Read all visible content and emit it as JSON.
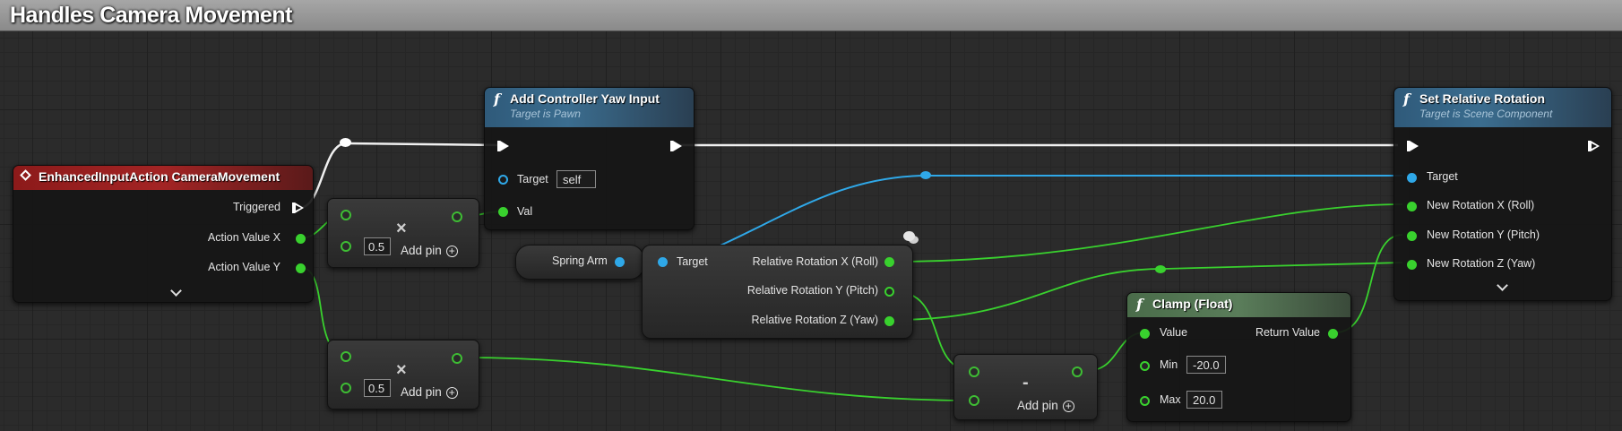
{
  "window": {
    "title": "Handles Camera Movement"
  },
  "colors": {
    "exec": "#ffffff",
    "float": "#39d12e",
    "object": "#2fa8e8",
    "event_header": "#a32424",
    "function_header": "#3b6d8f",
    "pure_header": "#5a7d5a"
  },
  "event_node": {
    "title": "EnhancedInputAction CameraMovement",
    "triggered": "Triggered",
    "action_x": "Action Value X",
    "action_y": "Action Value Y"
  },
  "yaw_node": {
    "title": "Add Controller Yaw Input",
    "subtitle": "Target is Pawn",
    "target_label": "Target",
    "target_value": "self",
    "val_label": "Val"
  },
  "mult_top": {
    "operator": "×",
    "value": "0.5",
    "add_pin": "Add pin"
  },
  "mult_bottom": {
    "operator": "×",
    "value": "0.5",
    "add_pin": "Add pin"
  },
  "spring_arm": {
    "label": "Spring Arm"
  },
  "break_rot": {
    "target_label": "Target",
    "roll": "Relative Rotation X (Roll)",
    "pitch": "Relative Rotation Y (Pitch)",
    "yaw": "Relative Rotation Z (Yaw)"
  },
  "subtract": {
    "operator": "-",
    "add_pin": "Add pin"
  },
  "clamp_node": {
    "title": "Clamp (Float)",
    "value_label": "Value",
    "return_label": "Return Value",
    "min_label": "Min",
    "min_value": "-20.0",
    "max_label": "Max",
    "max_value": "20.0"
  },
  "set_rot_node": {
    "title": "Set Relative Rotation",
    "subtitle": "Target is Scene Component",
    "target_label": "Target",
    "roll": "New Rotation X (Roll)",
    "pitch": "New Rotation Y (Pitch)",
    "yaw": "New Rotation Z (Yaw)"
  },
  "icons": {
    "function": "f",
    "event": "diamond",
    "expand": "chevron-down",
    "add": "plus-circle",
    "comment": "comment-bubble"
  }
}
